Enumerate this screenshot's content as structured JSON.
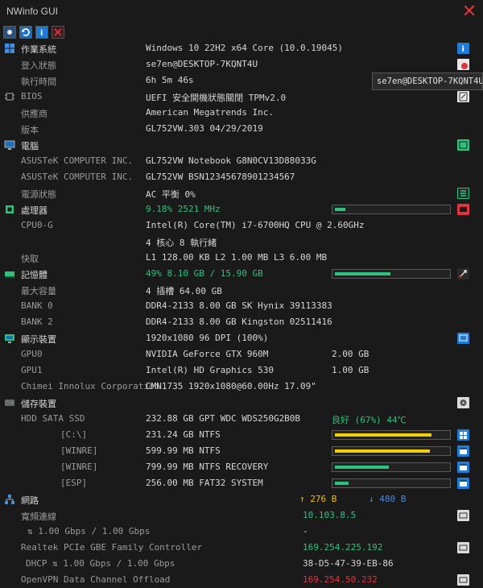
{
  "window": {
    "title": "NWinfo GUI"
  },
  "tooltip": "se7en@DESKTOP-7KQNT4U",
  "os": {
    "label": "作業系統",
    "value": "Windows 10 22H2 x64 Core (10.0.19045)",
    "login_label": "登入狀態",
    "login_value": "se7en@DESKTOP-7KQNT4U",
    "uptime_label": "執行時間",
    "uptime_value": "6h 5m 46s"
  },
  "bios": {
    "label": "BIOS",
    "value": "UEFI 安全開機狀態關閉 TPMv2.0",
    "vendor_label": "供應商",
    "vendor_value": "American Megatrends Inc.",
    "version_label": "版本",
    "version_value": "GL752VW.303 04/29/2019"
  },
  "computer": {
    "label": "電腦",
    "rows": [
      {
        "label": "ASUSTeK COMPUTER INC.",
        "value": "GL752VW Notebook G8N0CV13D88033G"
      },
      {
        "label": "ASUSTeK COMPUTER INC.",
        "value": "GL752VW BSN12345678901234567"
      }
    ],
    "power_label": "電源狀態",
    "power_value": "AC  平衡 0%"
  },
  "cpu": {
    "label": "處理器",
    "usage": "9.18% 2521 MHz",
    "usage_fraction": 0.09,
    "name_label": "CPU0-G",
    "name_value": "Intel(R) Core(TM) i7-6700HQ CPU @ 2.60GHz",
    "cores_value": "4 核心 8 執行緒",
    "cache_label": "快取",
    "cache_value": "L1 128.00 KB L2 1.00 MB L3 6.00 MB"
  },
  "memory": {
    "label": "記憶體",
    "usage": "49% 8.10 GB / 15.90 GB",
    "usage_fraction": 0.49,
    "max_label": "最大容量",
    "max_value": "4 插槽 64.00 GB",
    "banks": [
      {
        "label": "BANK 0",
        "value": "DDR4-2133 8.00 GB SK Hynix 39113383"
      },
      {
        "label": "BANK 2",
        "value": "DDR4-2133 8.00 GB Kingston 02511416"
      }
    ]
  },
  "display": {
    "label": "顯示裝置",
    "value": "1920x1080 96 DPI (100%)",
    "gpus": [
      {
        "label": "GPU0",
        "value": "NVIDIA GeForce GTX 960M",
        "mem": "2.00 GB"
      },
      {
        "label": "GPU1",
        "value": "Intel(R) HD Graphics 530",
        "mem": "1.00 GB"
      }
    ],
    "monitor_label": "Chimei Innolux Corporation",
    "monitor_value": "CMN1735 1920x1080@60.00Hz 17.09\""
  },
  "storage": {
    "label": "儲存裝置",
    "disk_label": "HDD SATA SSD",
    "disk_value": "232.88 GB GPT WDC WDS250G2B0B",
    "disk_health": "良好 (67%) 44℃",
    "volumes": [
      {
        "label": "[C:\\]",
        "value": "231.24 GB NTFS",
        "fraction": 0.86,
        "color": "#f0d000"
      },
      {
        "label": "[WINRE]",
        "value": "599.99 MB NTFS",
        "fraction": 0.84,
        "color": "#f0d000"
      },
      {
        "label": "[WINRE]",
        "value": "799.99 MB NTFS RECOVERY",
        "fraction": 0.48,
        "color": "#2ec27e"
      },
      {
        "label": "[ESP]",
        "value": "256.00 MB FAT32 SYSTEM",
        "fraction": 0.12,
        "color": "#2ec27e"
      }
    ]
  },
  "network": {
    "label": "網路",
    "up": "↑ 276 B",
    "down": "↓ 480 B",
    "broadband_label": "寬頻連線",
    "broadband_ip": "10.103.8.5",
    "broadband_speed": "⇅ 1.00 Gbps / 1.00 Gbps",
    "broadband_mac": "-",
    "eth_label": "Realtek PCIe GBE Family Controller",
    "eth_ip": "169.254.225.192",
    "eth_speed": "DHCP ⇅ 1.00 Gbps / 1.00 Gbps",
    "eth_mac": "38-D5-47-39-EB-86",
    "vpn_label": "OpenVPN Data Channel Offload",
    "vpn_ip": "169.254.50.232"
  },
  "colors": {
    "accent_green": "#2ec27e",
    "accent_red": "#e0343b",
    "accent_blue": "#1e7bd6",
    "accent_yellow": "#f0d000"
  }
}
